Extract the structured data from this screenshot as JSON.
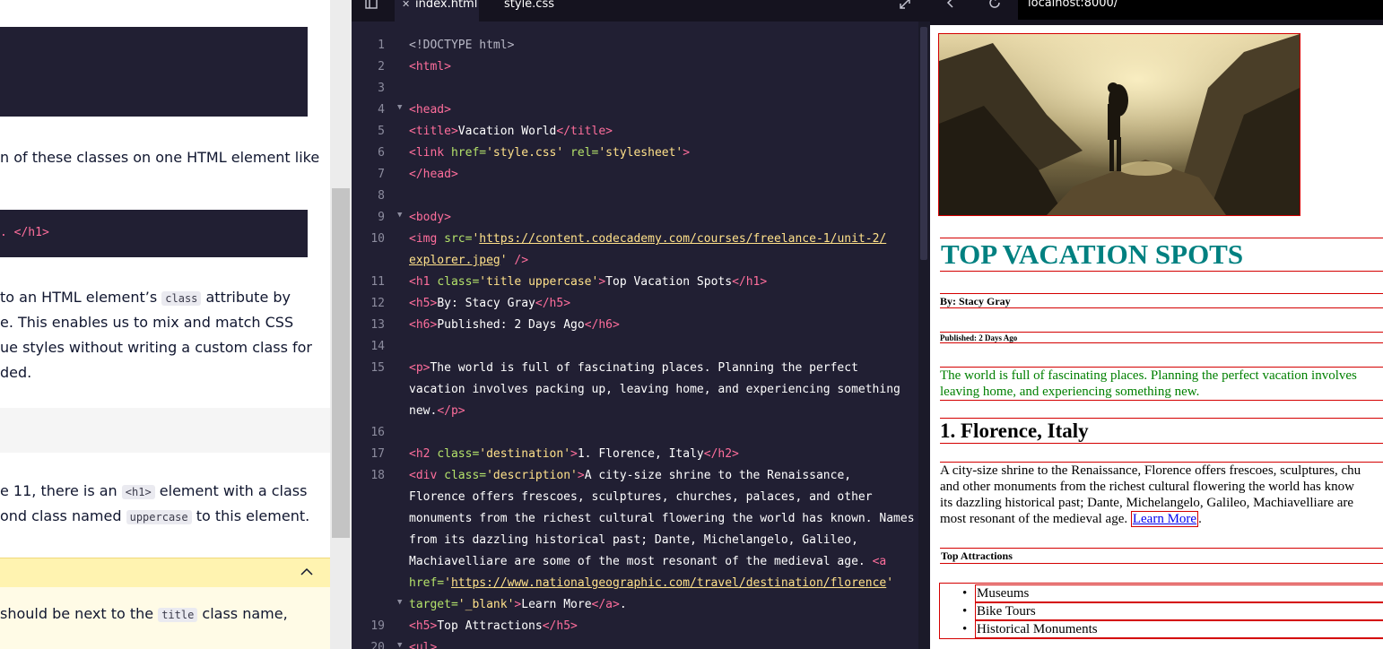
{
  "lesson": {
    "para1": "n of these classes on one HTML element like",
    "code_snippet_tail": ". </h1>",
    "para2_lines": [
      "to an HTML element’s ",
      "class",
      " attribute by",
      "e. This enables us to mix and match CSS",
      "ue styles without writing a custom class for",
      "ded."
    ],
    "step_line1_a": "e 11, there is an ",
    "step_line1_code": "<h1>",
    "step_line1_b": " element with a class",
    "step_line2_a": "ond class named ",
    "step_line2_code": "uppercase",
    "step_line2_b": " to this element.",
    "hint_a": "should be next to the ",
    "hint_code": "title",
    "hint_b": " class name,"
  },
  "editor": {
    "tabs": [
      "index.html",
      "style.css"
    ],
    "line_numbers": [
      "1",
      "2",
      "3",
      "4",
      "5",
      "6",
      "7",
      "8",
      "9",
      "10",
      "11",
      "12",
      "13",
      "14",
      "15",
      "16",
      "17",
      "18",
      "19",
      "20"
    ]
  },
  "browser": {
    "url": "localhost:8000/",
    "h1": "TOP VACATION SPOTS",
    "h5": "By: Stacy Gray",
    "h6": "Published: 2 Days Ago",
    "p": [
      "The world is full of fascinating places. Planning the perfect vacation involves",
      "leaving home, and experiencing something new."
    ],
    "h2": "1. Florence, Italy",
    "description": [
      "A city-size shrine to the Renaissance, Florence offers frescoes, sculptures, chu",
      "and other monuments from the richest cultural flowering the world has know",
      "its dazzling historical past; Dante, Michelangelo, Galileo, Machiavelliare are",
      "most resonant of the medieval age. "
    ],
    "learn_more": "Learn More",
    "attractions_title": "Top Attractions",
    "attractions": [
      "Museums",
      "Bike Tours",
      "Historical Monuments"
    ]
  },
  "colors": {
    "editor_bg": "#211f33",
    "tag": "#ff6e9c",
    "attr": "#b4e26a",
    "string": "#ffe18a",
    "h1_teal": "#008080",
    "p_green": "#008000",
    "outline_red": "#d40000"
  }
}
